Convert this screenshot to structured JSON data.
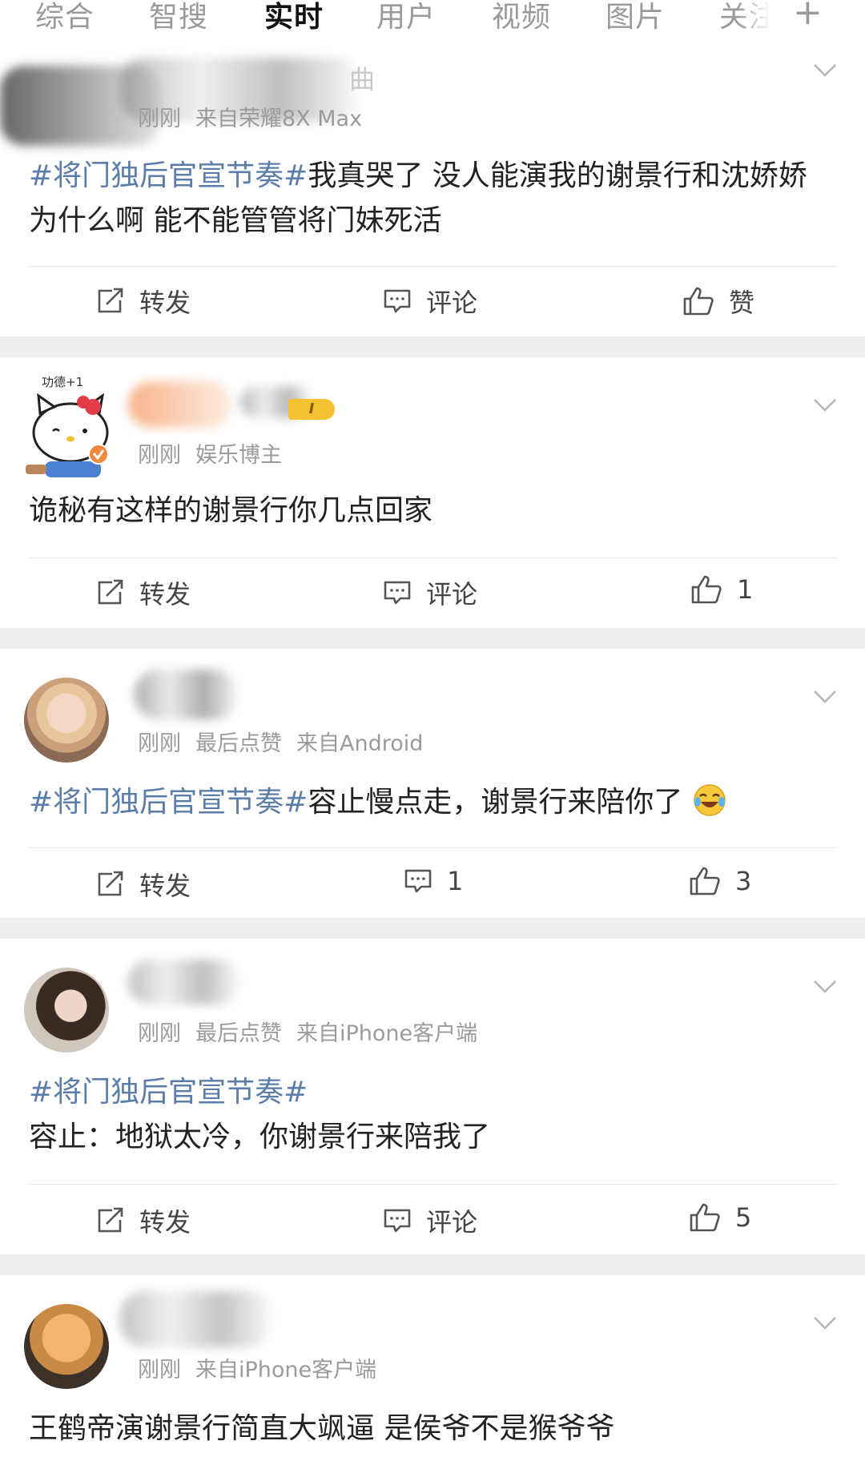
{
  "tabs": [
    "综合",
    "智搜",
    "实时",
    "用户",
    "视频",
    "图片",
    "关注"
  ],
  "active_tab": "实时",
  "icons": {
    "add": "plus-icon",
    "more": "chevron-down-icon",
    "repost": "repost-icon",
    "comment": "comment-icon",
    "like": "thumbs-up-icon",
    "verified": "verified-badge-icon",
    "emoji": "laughing-crying-emoji-icon"
  },
  "posts": [
    {
      "name_visible": "曲",
      "meta": [
        "刚刚",
        "来自荣耀8X Max"
      ],
      "hashtag": "#将门独后官宣节奏#",
      "text": "我真哭了 没人能演我的谢景行和沈娇娇 为什么啊 能不能管管将门妹死活",
      "repost": "转发",
      "comment": "评论",
      "like": "赞"
    },
    {
      "avatar_caption": "功德+1",
      "meta": [
        "刚刚",
        "娱乐博主"
      ],
      "level_badge": "I",
      "text": "诡秘有这样的谢景行你几点回家",
      "repost": "转发",
      "comment": "评论",
      "like": "1"
    },
    {
      "meta": [
        "刚刚",
        "最后点赞",
        "来自Android"
      ],
      "hashtag": "#将门独后官宣节奏#",
      "text": "容止慢点走，谢景行来陪你了",
      "repost": "转发",
      "comment": "1",
      "like": "3"
    },
    {
      "meta": [
        "刚刚",
        "最后点赞",
        "来自iPhone客户端"
      ],
      "hashtag": "#将门独后官宣节奏#",
      "text": "容止：地狱太冷，你谢景行来陪我了",
      "repost": "转发",
      "comment": "评论",
      "like": "5"
    },
    {
      "meta": [
        "刚刚",
        "来自iPhone客户端"
      ],
      "text": "王鹤帝演谢景行简直大飒逼 是侯爷不是猴爷爷"
    }
  ]
}
